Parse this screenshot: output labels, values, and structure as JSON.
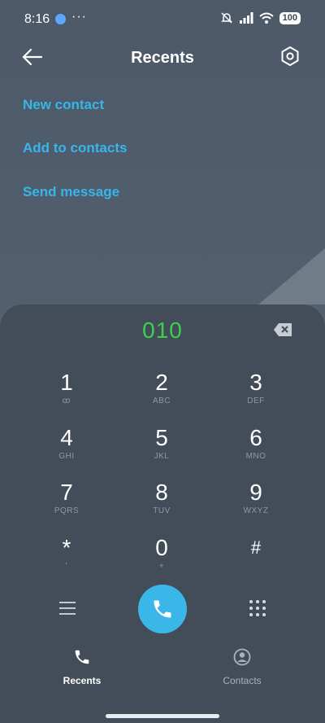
{
  "status_bar": {
    "time": "8:16",
    "more": "···",
    "battery": "100"
  },
  "header": {
    "title": "Recents"
  },
  "actions": [
    {
      "label": "New contact"
    },
    {
      "label": "Add to contacts"
    },
    {
      "label": "Send message"
    }
  ],
  "dialer": {
    "number": "010",
    "keys": [
      {
        "digit": "1",
        "letters": "ꝏ"
      },
      {
        "digit": "2",
        "letters": "ABC"
      },
      {
        "digit": "3",
        "letters": "DEF"
      },
      {
        "digit": "4",
        "letters": "GHI"
      },
      {
        "digit": "5",
        "letters": "JKL"
      },
      {
        "digit": "6",
        "letters": "MNO"
      },
      {
        "digit": "7",
        "letters": "PQRS"
      },
      {
        "digit": "8",
        "letters": "TUV"
      },
      {
        "digit": "9",
        "letters": "WXYZ"
      },
      {
        "digit": "*",
        "letters": "'"
      },
      {
        "digit": "0",
        "letters": "+"
      },
      {
        "digit": "#",
        "letters": ""
      }
    ]
  },
  "bottom_nav": [
    {
      "label": "Recents",
      "active": true
    },
    {
      "label": "Contacts",
      "active": false
    }
  ],
  "colors": {
    "accent": "#3ab7e8",
    "number": "#3fcf4d",
    "panel": "#434d59"
  }
}
